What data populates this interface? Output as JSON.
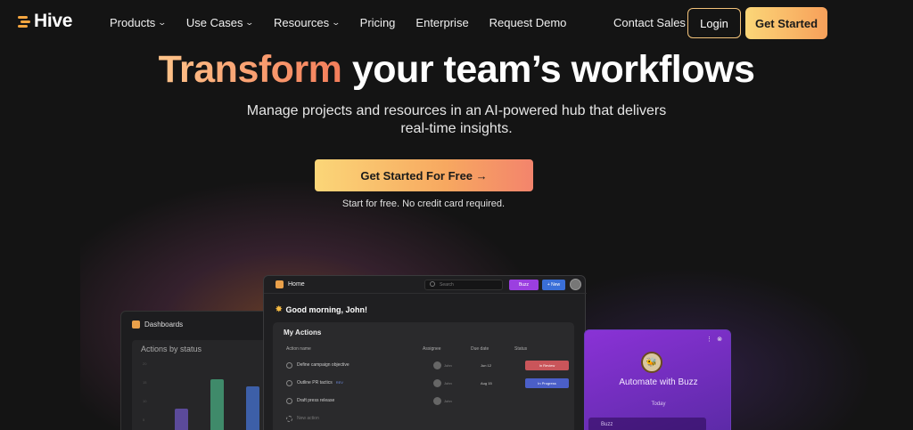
{
  "brand": {
    "name": "Hive",
    "accent": "#f4a640"
  },
  "nav": {
    "items": [
      {
        "label": "Products",
        "dropdown": true
      },
      {
        "label": "Use Cases",
        "dropdown": true
      },
      {
        "label": "Resources",
        "dropdown": true
      },
      {
        "label": "Pricing",
        "dropdown": false
      },
      {
        "label": "Enterprise",
        "dropdown": false
      },
      {
        "label": "Request Demo",
        "dropdown": false
      }
    ],
    "contact": "Contact Sales",
    "login": "Login",
    "get_started": "Get Started"
  },
  "hero": {
    "title_accent": "Transform",
    "title_rest": "your team’s workflows",
    "subtitle": "Manage projects and resources in an AI-powered hub that delivers real-time insights.",
    "cta": "Get Started For Free →",
    "cta_note": "Start for free. No credit card required."
  },
  "dashboards": {
    "title": "Dashboards",
    "card_title": "Actions by status",
    "axis_labels": [
      "20",
      "15",
      "10",
      "5"
    ],
    "bars": [
      {
        "value": 0.38,
        "color": "#5b4a9a"
      },
      {
        "value": 0.75,
        "color": "#3f8a6a"
      },
      {
        "value": 0.66,
        "color": "#3d5fa8"
      }
    ]
  },
  "home": {
    "title": "Home",
    "search_placeholder": "Search",
    "buzz_button": "Buzz",
    "new_button": "+ New",
    "greeting": "Good morning, John!",
    "actions_title": "My Actions",
    "columns": [
      "Action name",
      "Assignee",
      "Due date",
      "Status"
    ],
    "rows": [
      {
        "name": "Define campaign objective",
        "tag": "",
        "assignee": "John",
        "due": "Jun 12",
        "status": "In Review",
        "status_color": "#c9555a"
      },
      {
        "name": "Outline PR tactics",
        "tag": "REV",
        "assignee": "John",
        "due": "Aug 15",
        "status": "In Progress",
        "status_color": "#4b5fc8"
      },
      {
        "name": "Draft press release",
        "tag": "",
        "assignee": "John",
        "due": "",
        "status": "",
        "status_color": ""
      }
    ],
    "new_action": "New action"
  },
  "buzz": {
    "title": "Automate with Buzz",
    "today": "Today",
    "input_label": "Buzz"
  }
}
